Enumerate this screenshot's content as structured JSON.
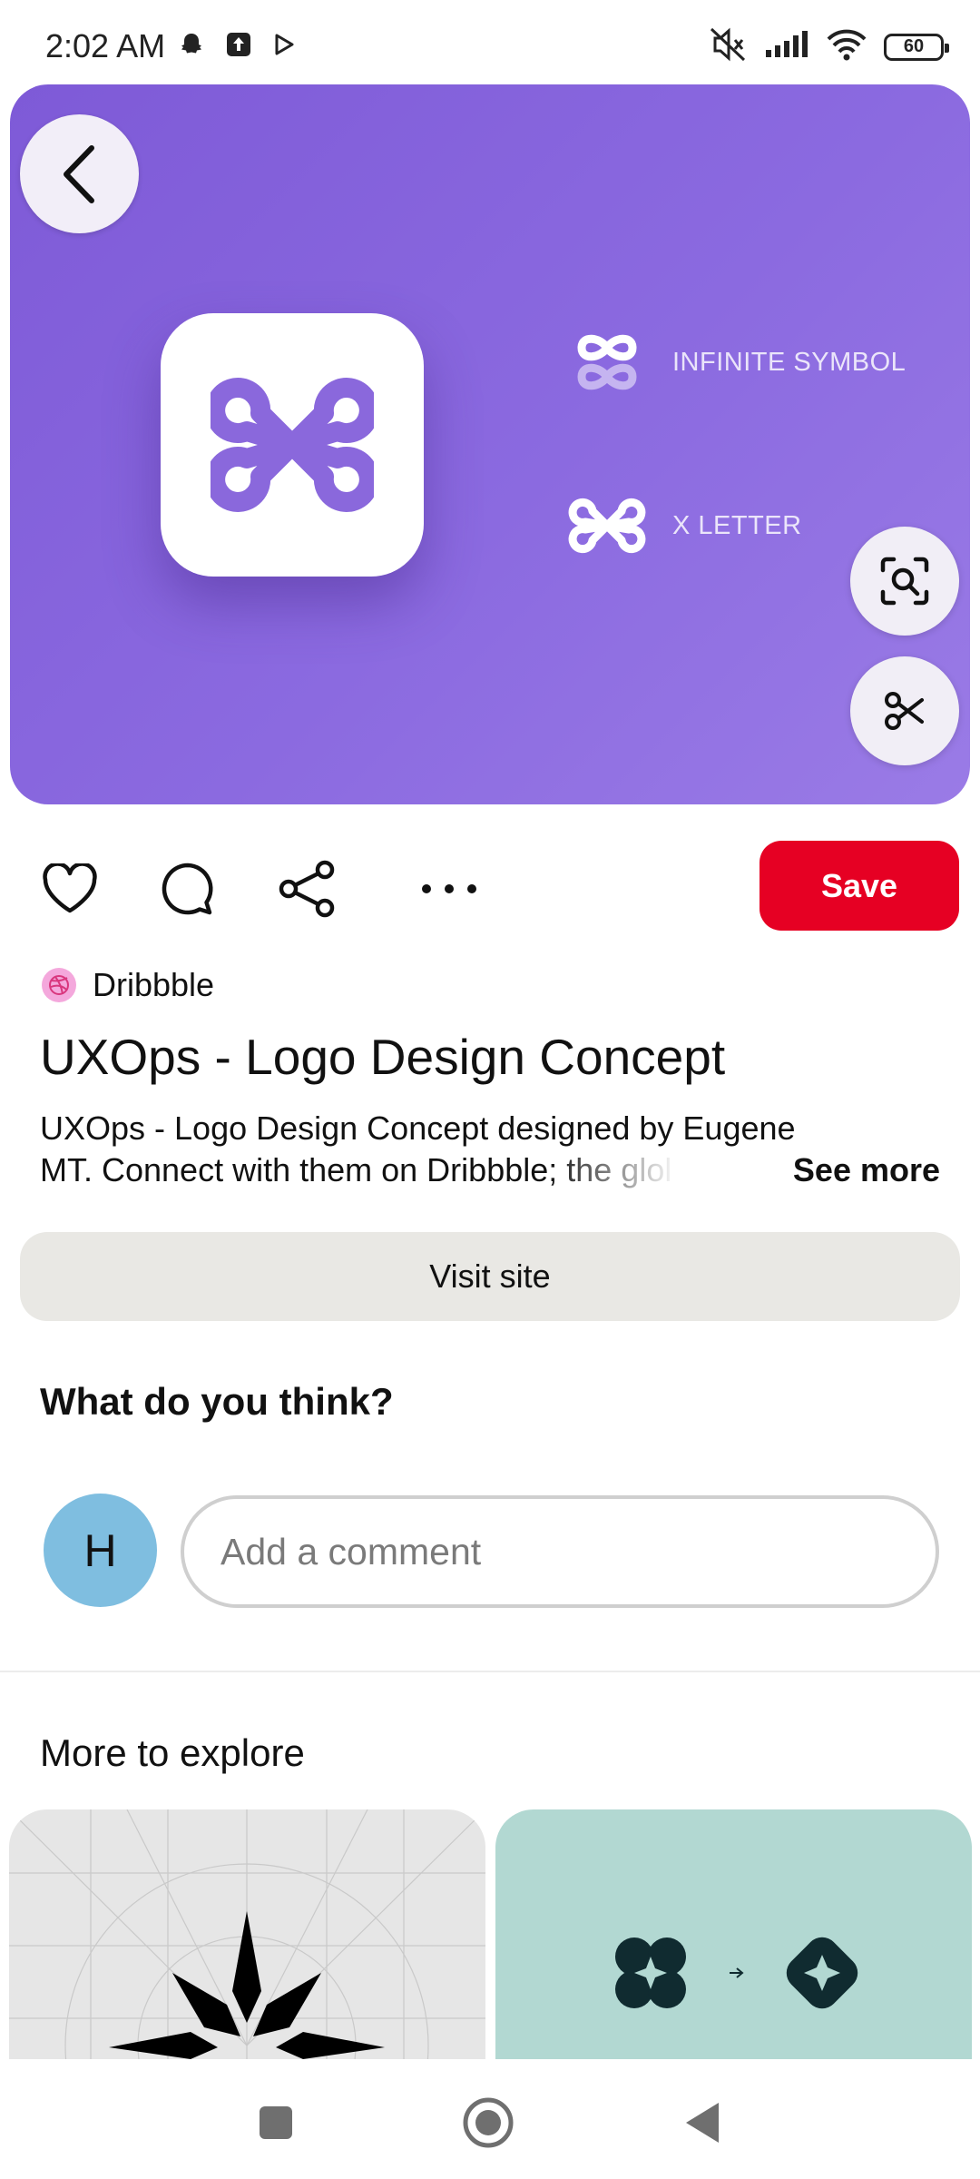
{
  "status_bar": {
    "time": "2:02 AM",
    "battery": "60",
    "left_icons": [
      "snapchat-icon",
      "upload-icon",
      "play-store-icon"
    ],
    "right_icons": [
      "mute-icon",
      "signal-icon",
      "wifi-icon",
      "battery-icon"
    ]
  },
  "hero": {
    "legend": [
      {
        "label": "INFINITE SYMBOL",
        "icon": "infinite-symbol-icon"
      },
      {
        "label": "X LETTER",
        "icon": "x-letter-icon"
      }
    ],
    "colors": {
      "background": "#8b6ae0",
      "logo": "#8a68dc"
    }
  },
  "actions": {
    "icons": [
      "heart-icon",
      "comment-icon",
      "share-icon",
      "more-icon"
    ],
    "save_label": "Save",
    "save_color": "#e60023"
  },
  "pin": {
    "source": "Dribbble",
    "title": "UXOps - Logo Design Concept",
    "description_line1": "UXOps - Logo Design Concept designed by Eugene",
    "description_line2": "MT. Connect with them on Dribbble; the glol",
    "see_more": "See more",
    "visit_label": "Visit site"
  },
  "comments": {
    "heading": "What do you think?",
    "avatar_initial": "H",
    "placeholder": "Add a comment"
  },
  "explore": {
    "heading": "More to explore"
  },
  "nav": {
    "icons": [
      "recents-icon",
      "home-icon",
      "back-icon"
    ]
  }
}
